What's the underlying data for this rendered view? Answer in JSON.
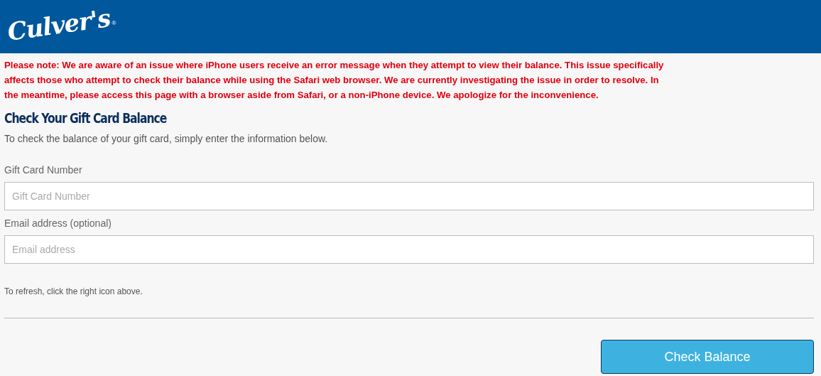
{
  "header": {
    "logo": "Culver's",
    "logo_mark": "®"
  },
  "notice": "Please note: We are aware of an issue where iPhone users receive an error message when they attempt to view their balance. This issue specifically affects those who attempt to check their balance while using the Safari web browser. We are currently investigating the issue in order to resolve. In the meantime, please access this page with a browser aside from Safari, or a non-iPhone device. We apologize for the inconvenience.",
  "heading": "Check Your Gift Card Balance",
  "intro": "To check the balance of your gift card, simply enter the information below.",
  "fields": [
    {
      "label": "Gift Card Number",
      "placeholder": "Gift Card Number"
    },
    {
      "label": "Email address (optional)",
      "placeholder": "Email address"
    }
  ],
  "refresh_hint": "To refresh, click the right icon above.",
  "submit_button": "Check Balance"
}
